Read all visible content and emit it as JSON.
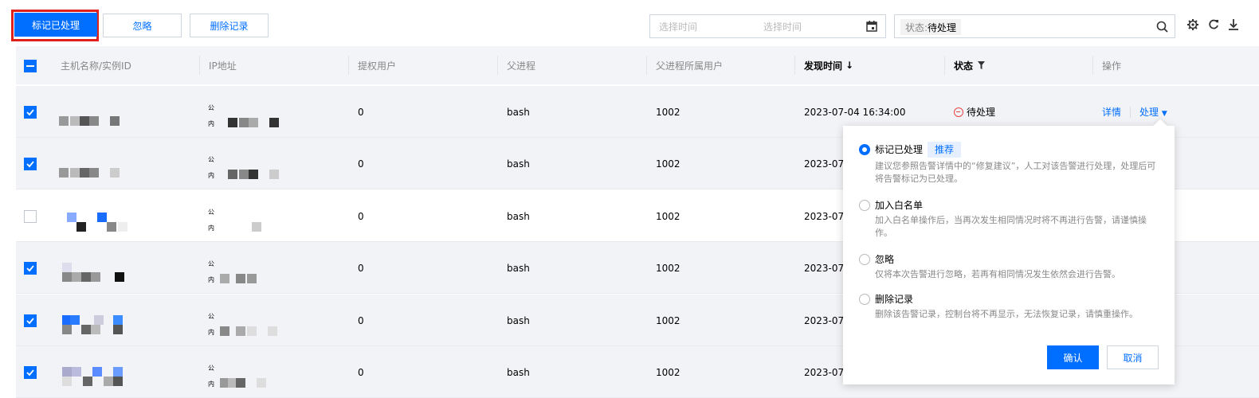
{
  "toolbar": {
    "mark_handled": "标记已处理",
    "ignore": "忽略",
    "delete_record": "删除记录",
    "date_start_placeholder": "选择时间",
    "date_end_placeholder": "选择时间",
    "filter_key": "状态:",
    "filter_value": "待处理",
    "icons": [
      "calendar-icon",
      "search-icon",
      "gear-icon",
      "refresh-icon",
      "download-icon"
    ]
  },
  "columns": {
    "host": "主机名称/实例ID",
    "ip": "IP地址",
    "user": "提权用户",
    "parent": "父进程",
    "parent_user": "父进程所属用户",
    "found_time": "发现时间",
    "sort_arrow": "↓",
    "status": "状态",
    "actions": "操作"
  },
  "ip_tags": {
    "public": "公",
    "private": "内"
  },
  "rows": [
    {
      "user": "0",
      "parent": "bash",
      "parent_user": "1002",
      "found_time": "2023-07-04 16:34:00",
      "status": "待处理",
      "detail": "详情",
      "handle": "处理",
      "selected": true
    },
    {
      "user": "0",
      "parent": "bash",
      "parent_user": "1002",
      "found_time": "2023-07-",
      "selected": true
    },
    {
      "user": "0",
      "parent": "bash",
      "parent_user": "1002",
      "found_time": "2023-07-",
      "selected": false
    },
    {
      "user": "0",
      "parent": "bash",
      "parent_user": "1002",
      "found_time": "2023-07-",
      "selected": true
    },
    {
      "user": "0",
      "parent": "bash",
      "parent_user": "1002",
      "found_time": "2023-07-",
      "selected": true
    },
    {
      "user": "0",
      "parent": "bash",
      "parent_user": "1002",
      "found_time": "2023-07-",
      "selected": true
    }
  ],
  "popover": {
    "options": [
      {
        "title": "标记已处理",
        "tag": "推荐",
        "desc": "建议您参照告警详情中的“修复建议”，人工对该告警进行处理，处理后可将告警标记为已处理。",
        "checked": true
      },
      {
        "title": "加入白名单",
        "desc": "加入白名单操作后，当再次发生相同情况时将不再进行告警，请谨慎操作。",
        "checked": false
      },
      {
        "title": "忽略",
        "desc": "仅将本次告警进行忽略，若再有相同情况发生依然会进行告警。",
        "checked": false
      },
      {
        "title": "删除记录",
        "desc": "删除该告警记录，控制台将不再显示，无法恢复记录，请慎重操作。",
        "checked": false
      }
    ],
    "confirm": "确认",
    "cancel": "取消"
  },
  "colors": {
    "accent": "#006eff",
    "danger": "#e54545",
    "highlight": "#e0201a"
  }
}
